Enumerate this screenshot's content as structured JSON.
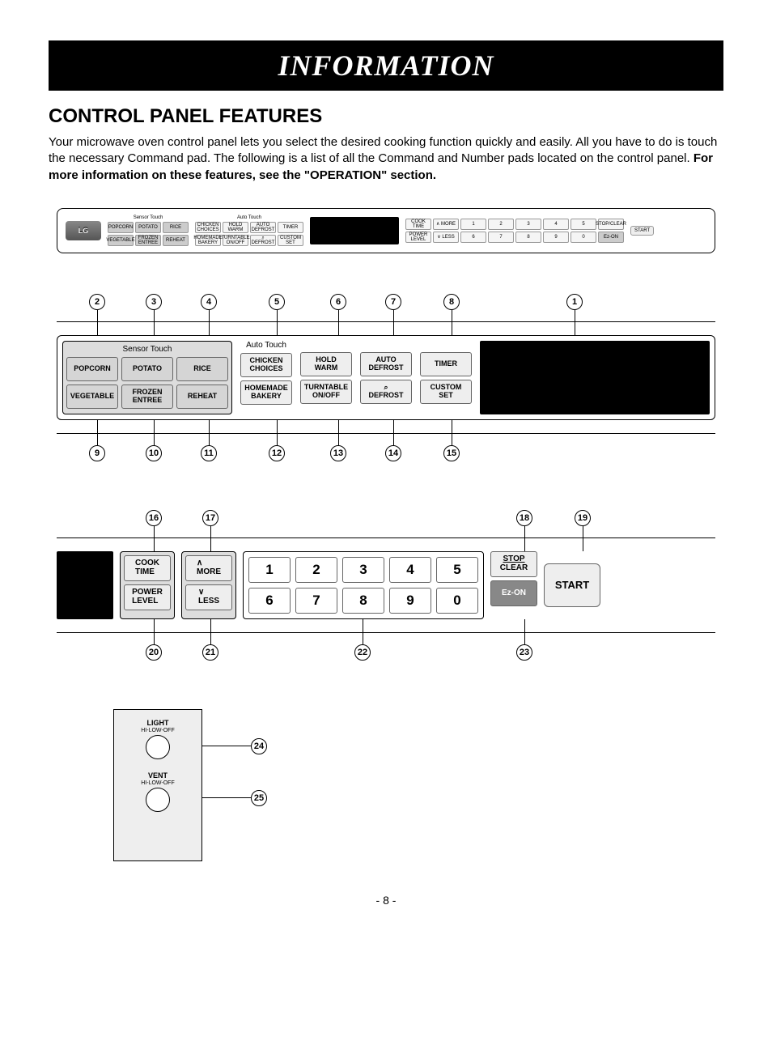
{
  "banner": "INFORMATION",
  "heading": "CONTROL PANEL FEATURES",
  "intro_plain": "Your microwave oven control panel lets you select the desired cooking function quickly and easily. All you have to do is touch the necessary Command pad. The following is a list of all the Command and Number pads located on the control panel. ",
  "intro_bold": "For more information on these features, see the \"OPERATION\" section.",
  "logo": "LG",
  "labels": {
    "sensor_touch": "Sensor Touch",
    "auto_touch": "Auto Touch"
  },
  "sensor_buttons_row1": [
    "POPCORN",
    "POTATO",
    "RICE"
  ],
  "sensor_buttons_row2": [
    "VEGETABLE",
    "FROZEN\nENTREE",
    "REHEAT"
  ],
  "auto_buttons_row1": [
    "CHICKEN\nCHOICES",
    "HOLD\nWARM",
    "AUTO\nDEFROST",
    "TIMER"
  ],
  "auto_buttons_row2": [
    "HOMEMADE\nBAKERY",
    "TURNTABLE\nON/OFF",
    "⌕\nDEFROST",
    "CUSTOM\nSET"
  ],
  "ctrl_col1": [
    "COOK\nTIME",
    "POWER\nLEVEL"
  ],
  "ctrl_col2": [
    "∧\nMORE",
    "∨\nLESS"
  ],
  "numbers_row1": [
    "1",
    "2",
    "3",
    "4",
    "5"
  ],
  "numbers_row2": [
    "6",
    "7",
    "8",
    "9",
    "0"
  ],
  "stop_clear_top": "STOP",
  "stop_clear_bot": "CLEAR",
  "ez_on": "Ez-ON",
  "start": "START",
  "knob1_label": "LIGHT",
  "knob1_sub": "HI-LOW-OFF",
  "knob2_label": "VENT",
  "knob2_sub": "HI-LOW-OFF",
  "callouts_top1": {
    "c2": "2",
    "c3": "3",
    "c4": "4",
    "c5": "5",
    "c6": "6",
    "c7": "7",
    "c8": "8",
    "c1": "1"
  },
  "callouts_bot1": {
    "c9": "9",
    "c10": "10",
    "c11": "11",
    "c12": "12",
    "c13": "13",
    "c14": "14",
    "c15": "15"
  },
  "callouts_top2": {
    "c16": "16",
    "c17": "17",
    "c18": "18",
    "c19": "19"
  },
  "callouts_bot2": {
    "c20": "20",
    "c21": "21",
    "c22": "22",
    "c23": "23"
  },
  "callouts_knob": {
    "c24": "24",
    "c25": "25"
  },
  "page_number": "- 8 -"
}
